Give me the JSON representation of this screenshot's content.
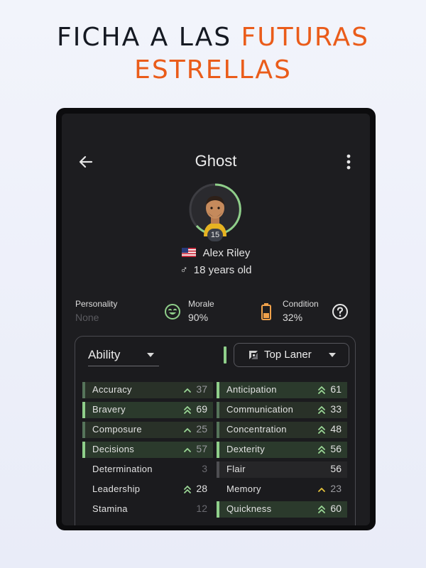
{
  "headline": {
    "part1": "FICHA A LAS ",
    "accent": "FUTURAS",
    "line2": "ESTRELLAS"
  },
  "colors": {
    "accent": "#ea5c1a",
    "green_bar": "#8fcf8a",
    "up_arrow": "#9ad695"
  },
  "header": {
    "title": "Ghost",
    "back_icon": "arrow-left-icon",
    "menu_icon": "more-vert-icon"
  },
  "player": {
    "level": "15",
    "flag_icon": "us-flag-icon",
    "name": "Alex Riley",
    "age_icon": "male-icon",
    "age": "18 years old"
  },
  "stats": {
    "personality": {
      "label": "Personality",
      "value": "None"
    },
    "morale": {
      "label": "Morale",
      "value": "90%",
      "icon": "smile-icon"
    },
    "condition": {
      "label": "Condition",
      "value": "32%",
      "icon": "battery-icon"
    },
    "help_icon": "help-circle-icon"
  },
  "panel": {
    "ability_label": "Ability",
    "role_label": "Top Laner",
    "left": [
      {
        "name": "Accuracy",
        "value": "37",
        "trend": "up",
        "hl": "dim"
      },
      {
        "name": "Bravery",
        "value": "69",
        "trend": "double",
        "hl": "full"
      },
      {
        "name": "Composure",
        "value": "25",
        "trend": "up",
        "hl": "dim"
      },
      {
        "name": "Decisions",
        "value": "57",
        "trend": "up",
        "hl": "full"
      },
      {
        "name": "Determination",
        "value": "3",
        "trend": "none",
        "hl": "none"
      },
      {
        "name": "Leadership",
        "value": "28",
        "trend": "double",
        "hl": "none"
      },
      {
        "name": "Stamina",
        "value": "12",
        "trend": "none",
        "hl": "none"
      }
    ],
    "right": [
      {
        "name": "Anticipation",
        "value": "61",
        "trend": "double",
        "hl": "full"
      },
      {
        "name": "Communication",
        "value": "33",
        "trend": "double",
        "hl": "dim"
      },
      {
        "name": "Concentration",
        "value": "48",
        "trend": "double",
        "hl": "dim"
      },
      {
        "name": "Dexterity",
        "value": "56",
        "trend": "double",
        "hl": "full"
      },
      {
        "name": "Flair",
        "value": "56",
        "trend": "none",
        "hl": "plain"
      },
      {
        "name": "Memory",
        "value": "23",
        "trend": "up-yellow",
        "hl": "none"
      },
      {
        "name": "Quickness",
        "value": "60",
        "trend": "double",
        "hl": "full"
      }
    ]
  }
}
